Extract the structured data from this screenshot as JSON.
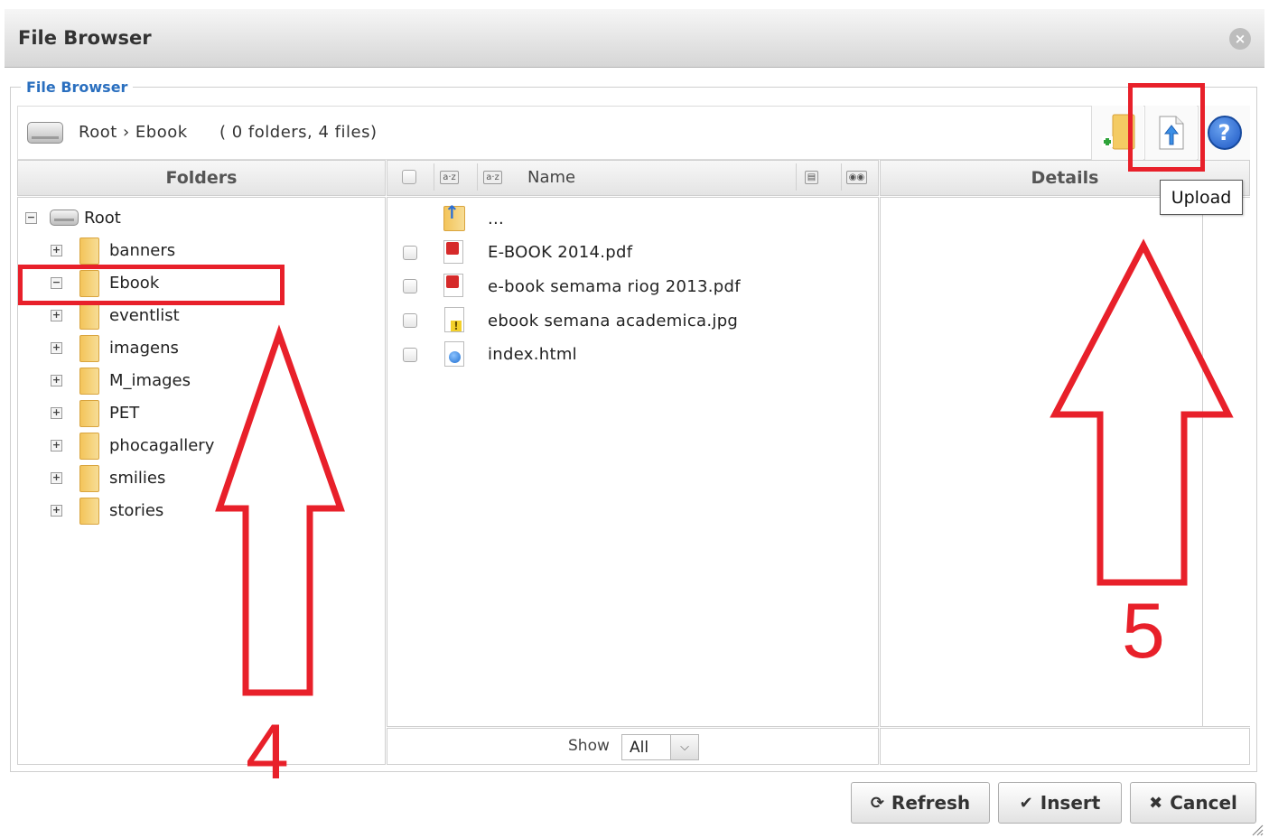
{
  "window": {
    "title": "File Browser",
    "close_glyph": "×"
  },
  "fieldset": {
    "legend": "File Browser"
  },
  "pathbar": {
    "path": "Root › Ebook",
    "info": "( 0 folders, 4 files)",
    "tools": [
      {
        "name": "new-folder",
        "icon": "new-folder-icon"
      },
      {
        "name": "upload",
        "icon": "upload-icon",
        "tooltip": "Upload"
      },
      {
        "name": "help",
        "icon": "help-icon",
        "glyph": "?"
      }
    ]
  },
  "columns": {
    "folders": "Folders",
    "name": "Name",
    "details": "Details"
  },
  "tree": {
    "root_label": "Root",
    "items": [
      {
        "label": "banners",
        "expanded": false,
        "selected": false
      },
      {
        "label": "Ebook",
        "expanded": true,
        "selected": true
      },
      {
        "label": "eventlist",
        "expanded": false,
        "selected": false
      },
      {
        "label": "imagens",
        "expanded": false,
        "selected": false
      },
      {
        "label": "M_images",
        "expanded": false,
        "selected": false
      },
      {
        "label": "PET",
        "expanded": false,
        "selected": false
      },
      {
        "label": "phocagallery",
        "expanded": false,
        "selected": false
      },
      {
        "label": "smilies",
        "expanded": false,
        "selected": false
      },
      {
        "label": "stories",
        "expanded": false,
        "selected": false
      }
    ]
  },
  "files": {
    "parent_label": "...",
    "items": [
      {
        "label": "E-BOOK 2014.pdf",
        "type": "pdf"
      },
      {
        "label": "e-book semama riog 2013.pdf",
        "type": "pdf"
      },
      {
        "label": "ebook semana academica.jpg",
        "type": "image"
      },
      {
        "label": "index.html",
        "type": "html"
      }
    ]
  },
  "footer": {
    "show_label": "Show",
    "show_value": "All"
  },
  "buttons": {
    "refresh": "Refresh",
    "insert": "Insert",
    "cancel": "Cancel"
  },
  "tooltip": "Upload",
  "annotations": {
    "step4": "4",
    "step5": "5",
    "color": "#e8202a"
  },
  "colors": {
    "accent": "#2a6fbf",
    "annotation": "#e8202a"
  }
}
